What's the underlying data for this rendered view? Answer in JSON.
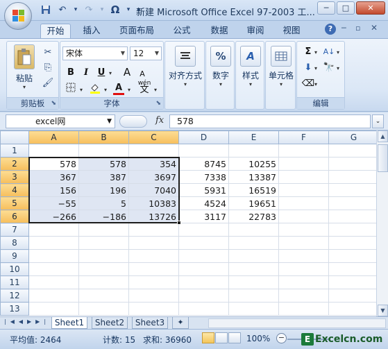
{
  "window": {
    "title": "新建 Microsoft Office Excel 97-2003 工...",
    "minimize": "─",
    "maximize": "□",
    "close": "✕"
  },
  "qat": {
    "undo": "↶",
    "redo": "↷",
    "omega": "Ω",
    "customize": "▾"
  },
  "tabs": [
    "开始",
    "插入",
    "页面布局",
    "公式",
    "数据",
    "审阅",
    "视图"
  ],
  "ribbon": {
    "clipboard": {
      "paste": "粘贴",
      "label": "剪贴板"
    },
    "font": {
      "name": "宋体",
      "size": "12",
      "bold": "B",
      "italic": "I",
      "underline": "U",
      "grow": "A",
      "shrink": "A",
      "label": "字体",
      "phonetic": "wén"
    },
    "alignment": {
      "label": "对齐方式"
    },
    "number": {
      "label": "数字",
      "icon": "%"
    },
    "styles": {
      "label": "样式"
    },
    "cells": {
      "label": "单元格"
    },
    "editing": {
      "label": "编辑",
      "sum": "Σ",
      "sort": "A↓"
    }
  },
  "formula_bar": {
    "name_box": "excel网",
    "fx": "fx",
    "value": "578"
  },
  "grid": {
    "columns": [
      "A",
      "B",
      "C",
      "D",
      "E",
      "F",
      "G"
    ],
    "rows": [
      [
        "",
        "",
        "",
        "",
        "",
        "",
        ""
      ],
      [
        "578",
        "578",
        "354",
        "8745",
        "10255",
        "",
        ""
      ],
      [
        "367",
        "387",
        "3697",
        "7338",
        "13387",
        "",
        ""
      ],
      [
        "156",
        "196",
        "7040",
        "5931",
        "16519",
        "",
        ""
      ],
      [
        "−55",
        "5",
        "10383",
        "4524",
        "19651",
        "",
        ""
      ],
      [
        "−266",
        "−186",
        "13726",
        "3117",
        "22783",
        "",
        ""
      ],
      [
        "",
        "",
        "",
        "",
        "",
        "",
        ""
      ],
      [
        "",
        "",
        "",
        "",
        "",
        "",
        ""
      ],
      [
        "",
        "",
        "",
        "",
        "",
        "",
        ""
      ],
      [
        "",
        "",
        "",
        "",
        "",
        "",
        ""
      ],
      [
        "",
        "",
        "",
        "",
        "",
        "",
        ""
      ],
      [
        "",
        "",
        "",
        "",
        "",
        "",
        ""
      ],
      [
        "",
        "",
        "",
        "",
        "",
        "",
        ""
      ]
    ],
    "row_numbers": [
      "1",
      "2",
      "3",
      "4",
      "5",
      "6",
      "7",
      "8",
      "9",
      "10",
      "11",
      "12",
      "13"
    ]
  },
  "sheets": [
    "Sheet1",
    "Sheet2",
    "Sheet3"
  ],
  "status": {
    "average": "平均值: 2464",
    "count": "计数: 15",
    "sum": "求和: 36960",
    "zoom": "100%"
  },
  "brand": {
    "logo_letter": "E",
    "text": "Excelcn.com"
  }
}
